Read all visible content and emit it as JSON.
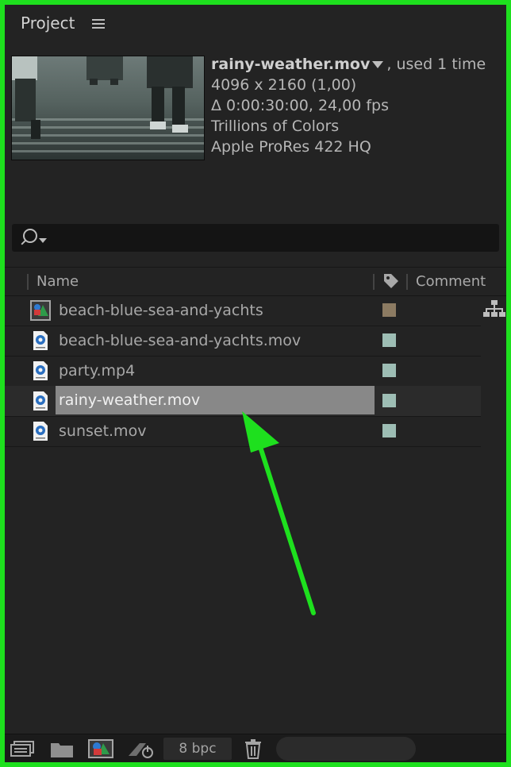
{
  "panel": {
    "title": "Project"
  },
  "preview": {
    "name": "rainy-weather.mov",
    "used": ", used 1 time",
    "resolution": "4096 x 2160 (1,00)",
    "duration": "Δ 0:00:30:00, 24,00 fps",
    "colors": "Trillions of Colors",
    "codec": "Apple ProRes 422 HQ"
  },
  "search": {
    "value": ""
  },
  "columns": {
    "name": "Name",
    "comment": "Comment"
  },
  "items": [
    {
      "label": "beach-blue-sea-and-yachts",
      "type": "composition",
      "label_color": "#8c7b62"
    },
    {
      "label": "beach-blue-sea-and-yachts.mov",
      "type": "footage-mov",
      "label_color": "#9dbdb4"
    },
    {
      "label": "party.mp4",
      "type": "footage-mp4",
      "label_color": "#9dbdb4"
    },
    {
      "label": "rainy-weather.mov",
      "type": "footage-mov",
      "label_color": "#9dbdb4",
      "selected": true
    },
    {
      "label": "sunset.mov",
      "type": "footage-mov",
      "label_color": "#9dbdb4"
    }
  ],
  "footer": {
    "bpc": "8 bpc"
  },
  "colors": {
    "frame_border": "#1ee01e",
    "annotation_arrow": "#1ee01e",
    "selection": "#888888"
  }
}
